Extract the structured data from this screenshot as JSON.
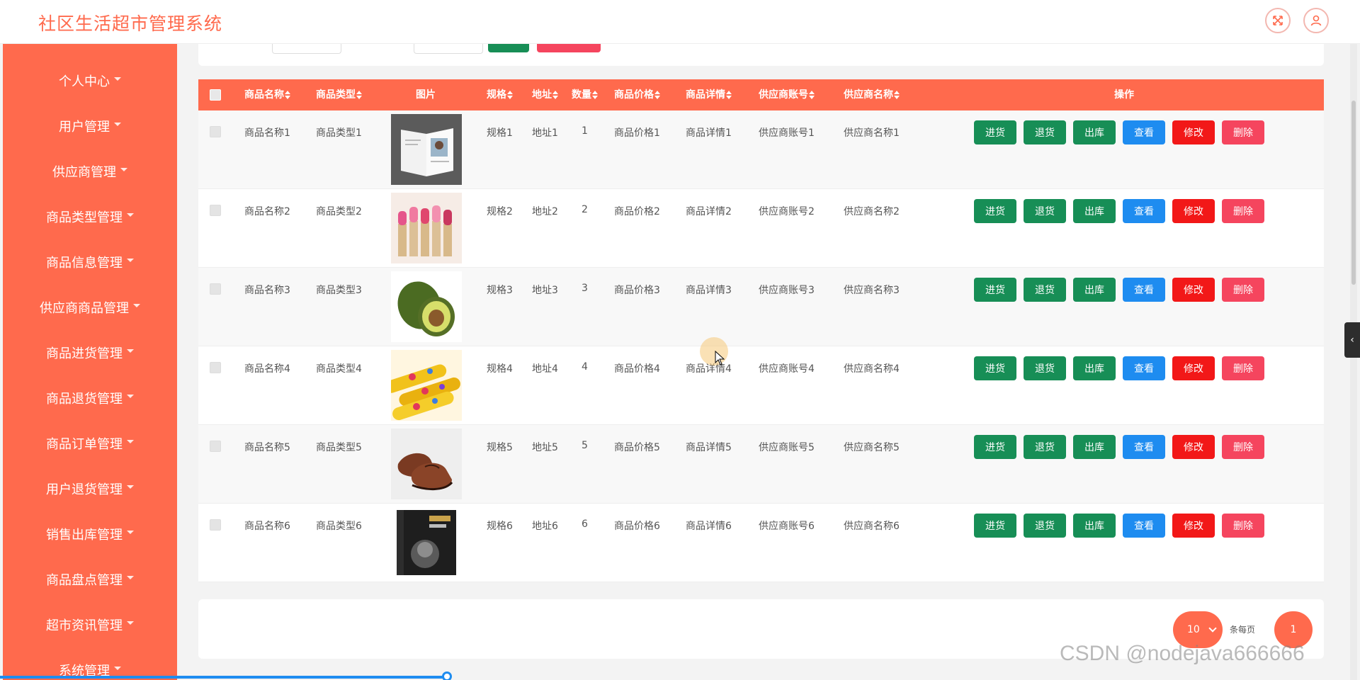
{
  "header": {
    "title": "社区生活超市管理系统",
    "fullscreen_icon": "fullscreen-icon",
    "user_icon": "user-icon"
  },
  "sidebar": {
    "items": [
      {
        "label": "个人中心"
      },
      {
        "label": "用户管理"
      },
      {
        "label": "供应商管理"
      },
      {
        "label": "商品类型管理"
      },
      {
        "label": "商品信息管理"
      },
      {
        "label": "供应商商品管理"
      },
      {
        "label": "商品进货管理"
      },
      {
        "label": "商品退货管理"
      },
      {
        "label": "商品订单管理"
      },
      {
        "label": "用户退货管理"
      },
      {
        "label": "销售出库管理"
      },
      {
        "label": "商品盘点管理"
      },
      {
        "label": "超市资讯管理"
      },
      {
        "label": "系统管理"
      }
    ]
  },
  "colors": {
    "primary": "#ff6a4d",
    "green": "#178e56",
    "blue": "#1e8cf0",
    "red": "#f21818",
    "pink": "#f5455e"
  },
  "table": {
    "columns": {
      "name": "商品名称",
      "type": "商品类型",
      "image": "图片",
      "spec": "规格",
      "address": "地址",
      "qty": "数量",
      "price": "商品价格",
      "detail": "商品详情",
      "supplier_account": "供应商账号",
      "supplier_name": "供应商名称",
      "actions": "操作"
    },
    "actions": {
      "purchase": "进货",
      "return": "退货",
      "outbound": "出库",
      "view": "查看",
      "edit": "修改",
      "delete": "删除"
    },
    "rows": [
      {
        "name": "商品名称1",
        "type": "商品类型1",
        "image": "magazine",
        "spec": "规格1",
        "address": "地址1",
        "qty": "1",
        "price": "商品价格1",
        "detail": "商品详情1",
        "supplier_account": "供应商账号1",
        "supplier_name": "供应商名称1"
      },
      {
        "name": "商品名称2",
        "type": "商品类型2",
        "image": "lipsticks",
        "spec": "规格2",
        "address": "地址2",
        "qty": "2",
        "price": "商品价格2",
        "detail": "商品详情2",
        "supplier_account": "供应商账号2",
        "supplier_name": "供应商名称2"
      },
      {
        "name": "商品名称3",
        "type": "商品类型3",
        "image": "avocado",
        "spec": "规格3",
        "address": "地址3",
        "qty": "3",
        "price": "商品价格3",
        "detail": "商品详情3",
        "supplier_account": "供应商账号3",
        "supplier_name": "供应商名称3"
      },
      {
        "name": "商品名称4",
        "type": "商品类型4",
        "image": "candy-tubes",
        "spec": "规格4",
        "address": "地址4",
        "qty": "4",
        "price": "商品价格4",
        "detail": "商品详情4",
        "supplier_account": "供应商账号4",
        "supplier_name": "供应商名称4"
      },
      {
        "name": "商品名称5",
        "type": "商品类型5",
        "image": "leather-shoes",
        "spec": "规格5",
        "address": "地址5",
        "qty": "5",
        "price": "商品价格5",
        "detail": "商品详情5",
        "supplier_account": "供应商账号5",
        "supplier_name": "供应商名称5"
      },
      {
        "name": "商品名称6",
        "type": "商品类型6",
        "image": "book-cover",
        "spec": "规格6",
        "address": "地址6",
        "qty": "6",
        "price": "商品价格6",
        "detail": "商品详情6",
        "supplier_account": "供应商账号6",
        "supplier_name": "供应商名称6"
      }
    ]
  },
  "pager": {
    "page_size": "10",
    "per_page_label": "条每页",
    "current_page": "1"
  },
  "watermark": "CSDN @nodejava666666"
}
